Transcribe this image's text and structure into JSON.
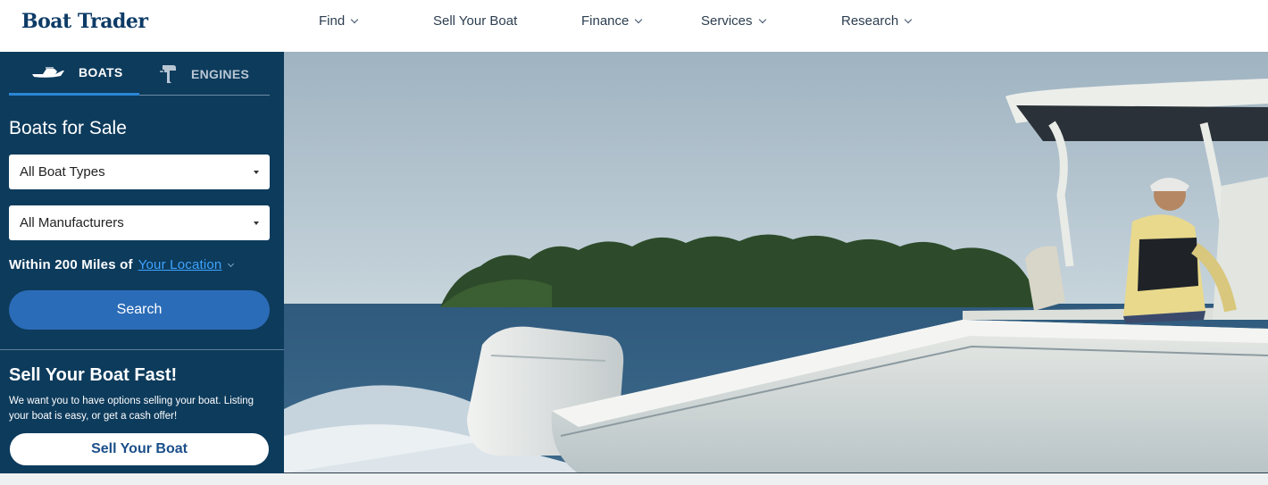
{
  "header": {
    "logo": "Boat Trader",
    "nav": [
      {
        "label": "Find",
        "has_dropdown": true
      },
      {
        "label": "Sell Your Boat",
        "has_dropdown": false
      },
      {
        "label": "Finance",
        "has_dropdown": true
      },
      {
        "label": "Services",
        "has_dropdown": true
      },
      {
        "label": "Research",
        "has_dropdown": true
      }
    ]
  },
  "search_panel": {
    "tabs": [
      {
        "label": "BOATS",
        "icon": "boat-icon",
        "active": true
      },
      {
        "label": "ENGINES",
        "icon": "outboard-engine-icon",
        "active": false
      }
    ],
    "title": "Boats for Sale",
    "boat_type_select": "All Boat Types",
    "manufacturer_select": "All Manufacturers",
    "radius_prefix": "Within 200 Miles of",
    "location_link": "Your Location",
    "search_button": "Search"
  },
  "sell_promo": {
    "title": "Sell Your Boat Fast!",
    "description": "We want you to have options selling your boat. Listing your boat is easy, or get a cash offer!",
    "button": "Sell Your Boat"
  },
  "hero": {
    "image": "center-console-boat-on-water-photo"
  },
  "colors": {
    "brand_navy": "#0d3b5c",
    "logo": "#0d3b66",
    "search_button": "#2b6cb8",
    "active_tab_underline": "#2a86d6",
    "link": "#3ea4ff"
  }
}
